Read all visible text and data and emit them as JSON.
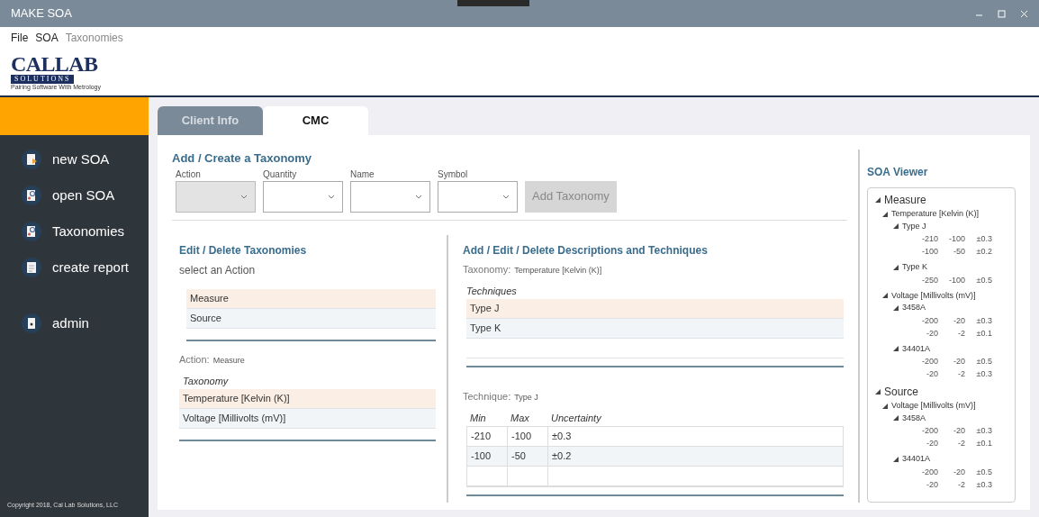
{
  "window": {
    "title": "MAKE SOA"
  },
  "menu": [
    {
      "label": "File",
      "disabled": false
    },
    {
      "label": "SOA",
      "disabled": false
    },
    {
      "label": "Taxonomies",
      "disabled": true
    }
  ],
  "logo": {
    "name": "CALLAB",
    "sub": "SOLUTIONS",
    "tagline": "Pairing Software With Metrology"
  },
  "sidebar": {
    "items": [
      {
        "label": "new SOA",
        "kind": "new"
      },
      {
        "label": "open SOA",
        "kind": "open"
      },
      {
        "label": "Taxonomies",
        "kind": "open"
      },
      {
        "label": "create report",
        "kind": "report"
      },
      {
        "label": "admin",
        "kind": "admin"
      }
    ],
    "copyright": "Copyright 2018, Cal Lab Solutions, LLC"
  },
  "tabs": [
    {
      "label": "Client Info",
      "selected": false
    },
    {
      "label": "CMC",
      "selected": true
    }
  ],
  "add_taxonomy": {
    "title": "Add / Create a Taxonomy",
    "fields": [
      {
        "label": "Action",
        "disabled": true
      },
      {
        "label": "Quantity",
        "disabled": false
      },
      {
        "label": "Name",
        "disabled": false
      },
      {
        "label": "Symbol",
        "disabled": false
      }
    ],
    "button": {
      "label": "Add Taxonomy",
      "disabled": true
    }
  },
  "edit_taxonomies": {
    "title": "Edit / Delete Taxonomies",
    "prompt": "select an Action",
    "actions": [
      {
        "label": "Measure",
        "selected": true
      },
      {
        "label": "Source",
        "selected": false
      }
    ],
    "action_label": "Action:",
    "action_value": "Measure",
    "column": "Taxonomy",
    "taxonomies": [
      {
        "label": "Temperature [Kelvin (K)]",
        "selected": true
      },
      {
        "label": "Voltage [Millivolts (mV)]",
        "selected": false
      }
    ]
  },
  "techniques": {
    "title": "Add / Edit / Delete Descriptions and Techniques",
    "taxonomy_label": "Taxonomy:",
    "taxonomy_value": "Temperature [Kelvin (K)]",
    "column": "Techniques",
    "items": [
      {
        "label": "Type J",
        "selected": true
      },
      {
        "label": "Type K",
        "selected": false
      }
    ],
    "technique_label": "Technique:",
    "technique_value": "Type J",
    "columns": [
      "Min",
      "Max",
      "Uncertainty"
    ],
    "rows": [
      [
        "-210",
        "-100",
        "±0.3"
      ],
      [
        "-100",
        "-50",
        "±0.2"
      ]
    ]
  },
  "soa_viewer": {
    "title": "SOA Viewer",
    "tree": [
      {
        "label": "Measure",
        "expanded": true,
        "children": [
          {
            "label": "Temperature [Kelvin (K)]",
            "expanded": true,
            "children": [
              {
                "label": "Type J",
                "expanded": true,
                "rows": [
                  [
                    "-210",
                    "-100",
                    "±0.3"
                  ],
                  [
                    "-100",
                    "-50",
                    "±0.2"
                  ]
                ]
              },
              {
                "label": "Type K",
                "expanded": true,
                "rows": [
                  [
                    "-250",
                    "-100",
                    "±0.5"
                  ]
                ]
              }
            ]
          },
          {
            "label": "Voltage [Millivolts (mV)]",
            "expanded": true,
            "children": [
              {
                "label": "3458A",
                "expanded": true,
                "rows": [
                  [
                    "-200",
                    "-20",
                    "±0.3"
                  ],
                  [
                    "-20",
                    "-2",
                    "±0.1"
                  ]
                ]
              },
              {
                "label": "34401A",
                "expanded": true,
                "rows": [
                  [
                    "-200",
                    "-20",
                    "±0.5"
                  ],
                  [
                    "-20",
                    "-2",
                    "±0.3"
                  ]
                ]
              }
            ]
          }
        ]
      },
      {
        "label": "Source",
        "expanded": true,
        "children": [
          {
            "label": "Voltage [Millivolts (mV)]",
            "expanded": true,
            "children": [
              {
                "label": "3458A",
                "expanded": true,
                "rows": [
                  [
                    "-200",
                    "-20",
                    "±0.3"
                  ],
                  [
                    "-20",
                    "-2",
                    "±0.1"
                  ]
                ]
              },
              {
                "label": "34401A",
                "expanded": true,
                "rows": [
                  [
                    "-200",
                    "-20",
                    "±0.5"
                  ],
                  [
                    "-20",
                    "-2",
                    "±0.3"
                  ]
                ]
              }
            ]
          }
        ]
      }
    ]
  }
}
